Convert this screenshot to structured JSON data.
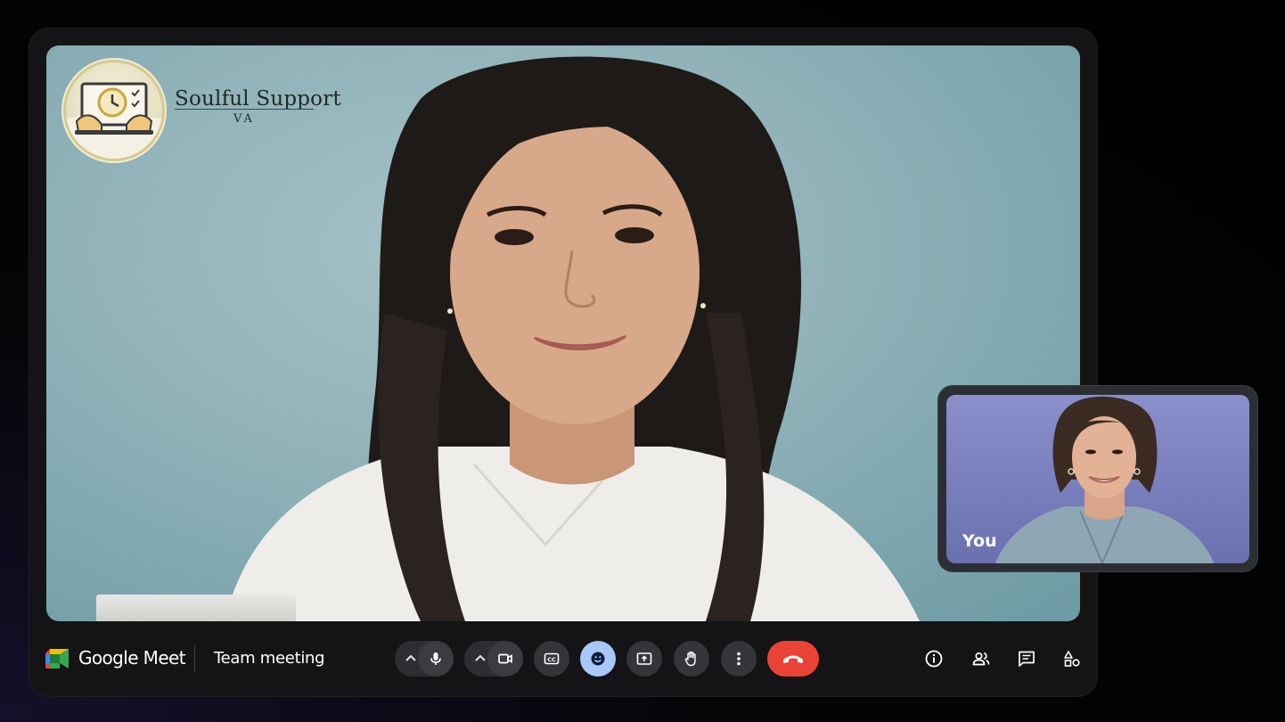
{
  "brand": {
    "name": "Soulful Support",
    "sub": "VA"
  },
  "self_view": {
    "label": "You"
  },
  "toolbar": {
    "app_name": "Google Meet",
    "meeting_title": "Team meeting",
    "buttons": {
      "audio_options": "chevron-up-icon",
      "microphone": "microphone-icon",
      "video_options": "chevron-up-icon",
      "camera": "camera-icon",
      "captions": "captions-icon",
      "reactions": "emoji-icon",
      "present": "present-screen-icon",
      "raise_hand": "hand-icon",
      "more": "more-vert-icon",
      "leave_call": "phone-hangup-icon"
    },
    "right": [
      "info-icon",
      "people-icon",
      "chat-icon",
      "activities-icon"
    ]
  },
  "colors": {
    "end_call": "#ea4335",
    "reaction_active": "#a8c7fa",
    "toolbar_bg": "#141416"
  }
}
